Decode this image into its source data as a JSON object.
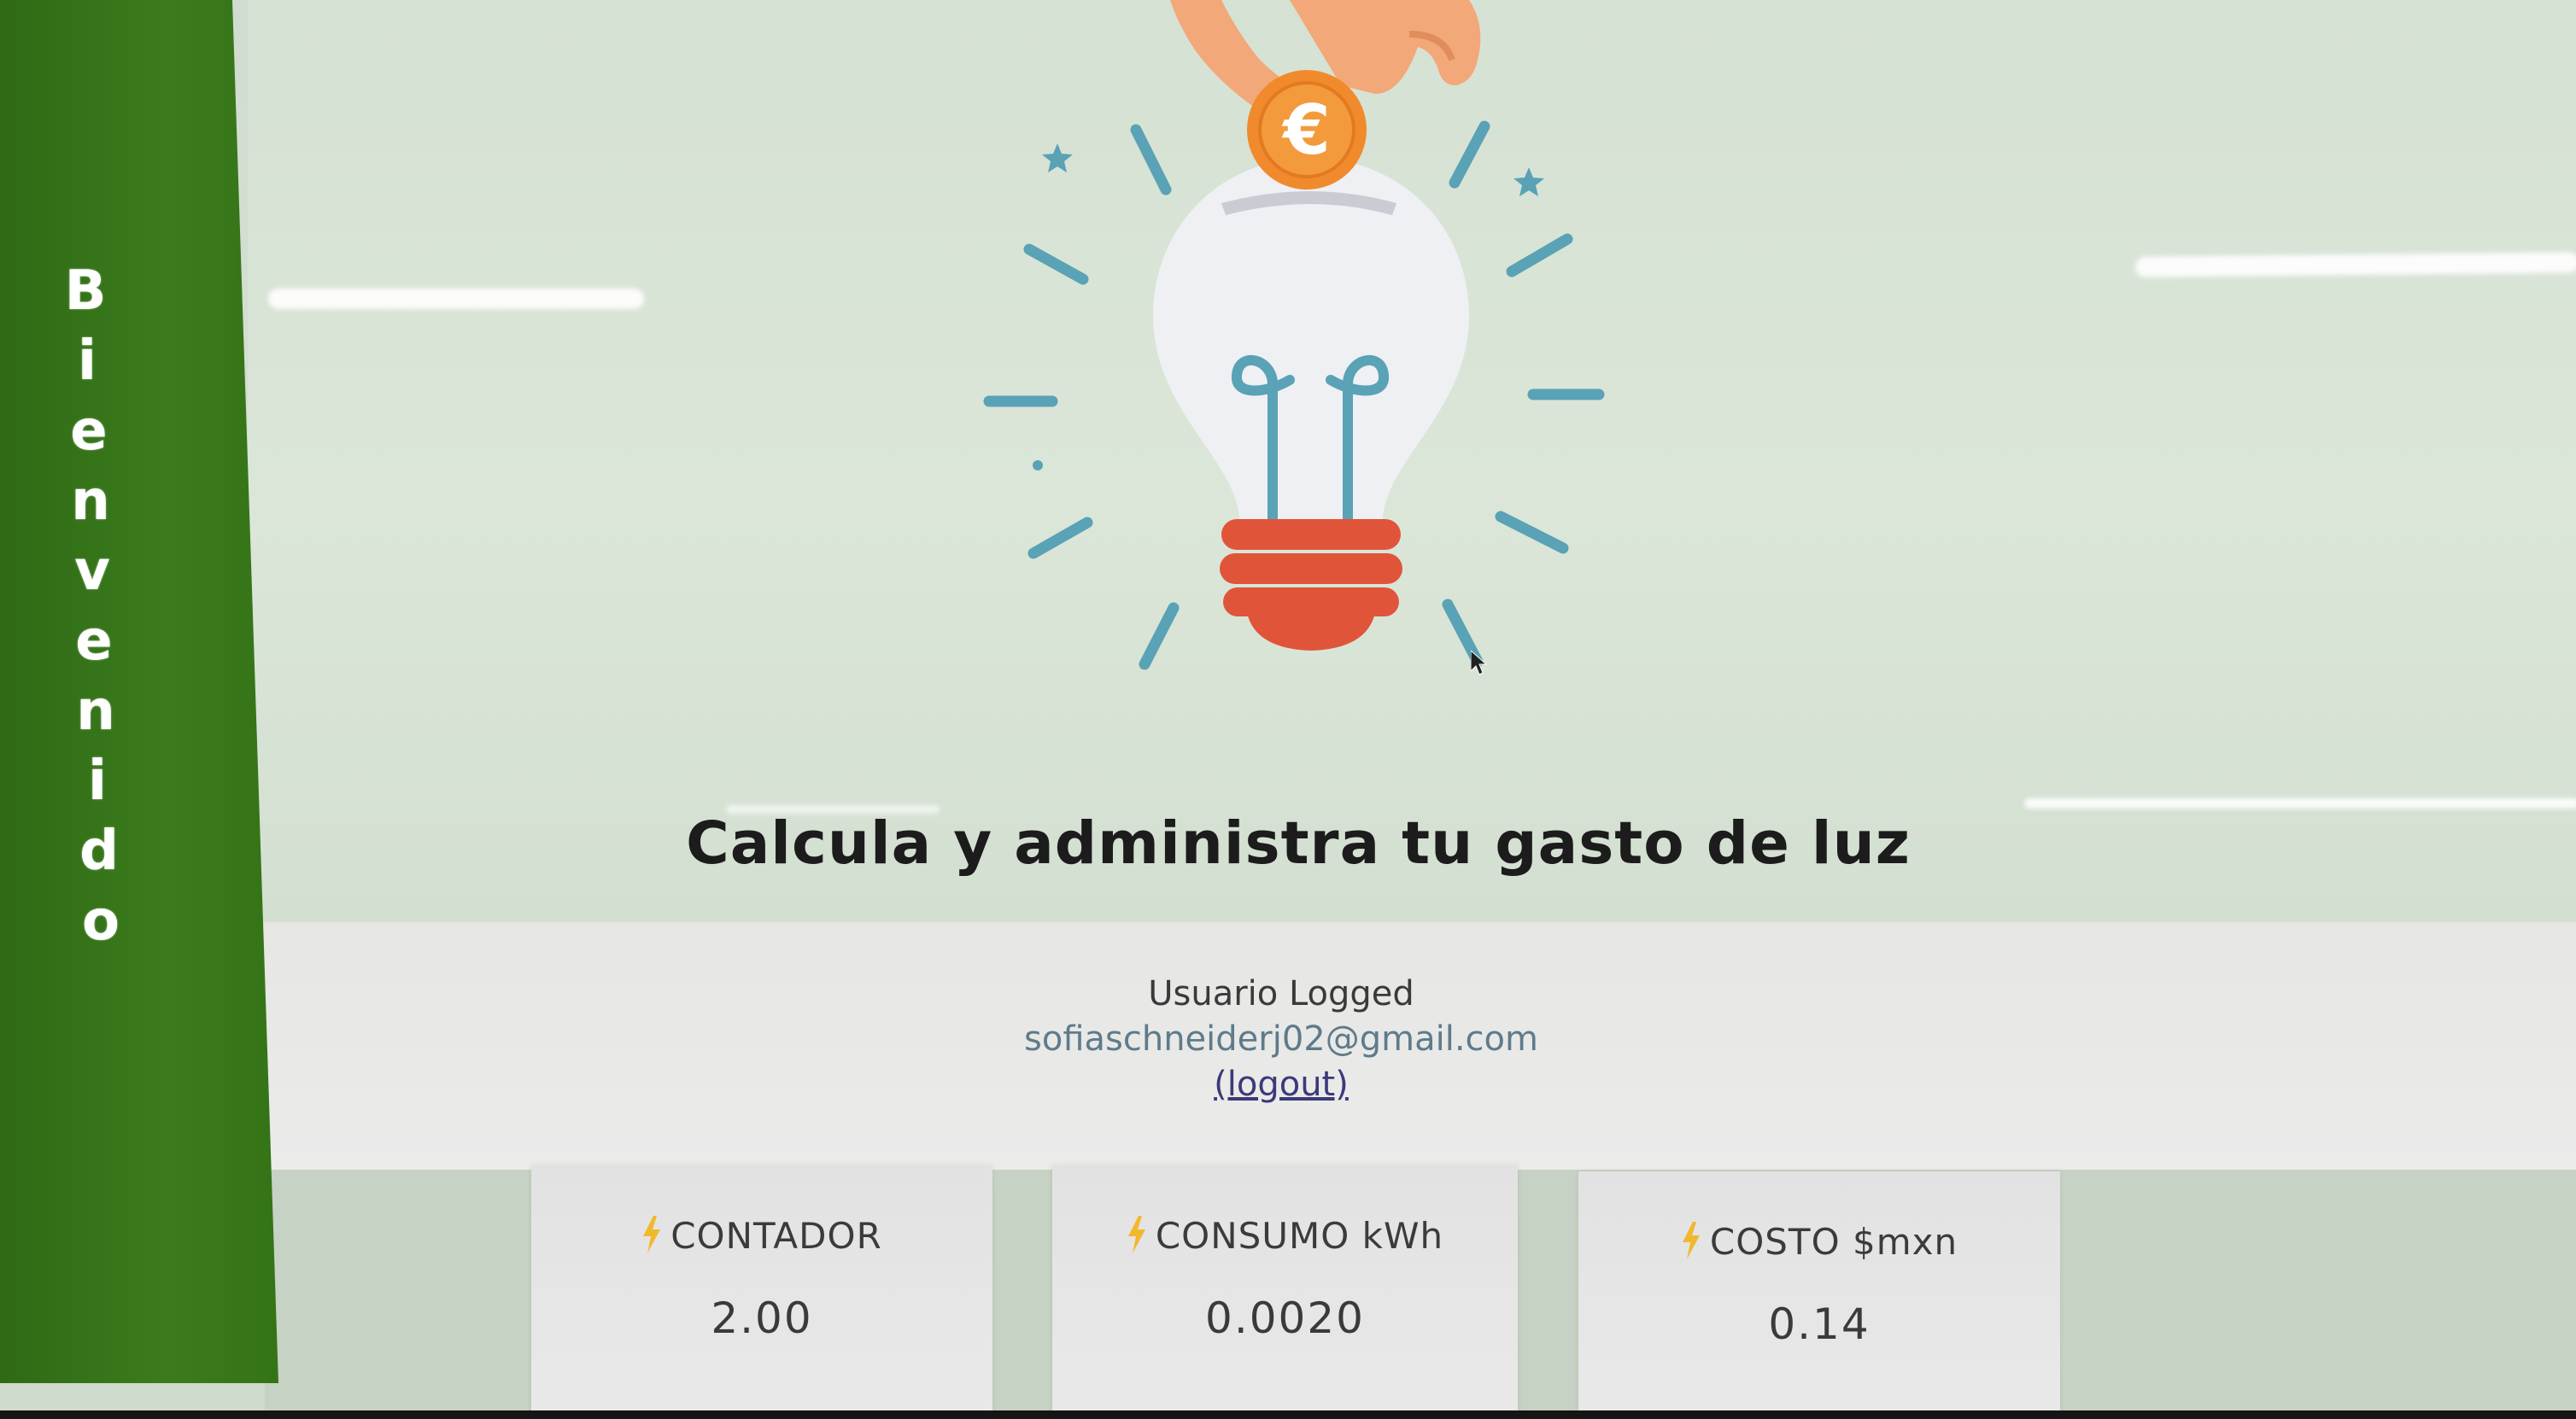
{
  "sidebar": {
    "letters": [
      "B",
      "i",
      "e",
      "n",
      "v",
      "e",
      "n",
      "i",
      "d",
      "o"
    ],
    "bg_color": "#3b7b1d"
  },
  "hero": {
    "title": "Calcula y administra tu gasto de luz",
    "illustration": {
      "icon_names": [
        "hand-icon",
        "euro-coin-icon",
        "light-bulb-icon"
      ],
      "coin_symbol": "€",
      "ray_color": "#5aa2b5",
      "base_color": "#e0553a",
      "coin_color": "#f08a2c"
    }
  },
  "user": {
    "label": "Usuario Logged",
    "email": "sofiaschneiderj02@gmail.com",
    "logout_label": "(logout)"
  },
  "cards": [
    {
      "label": "CONTADOR",
      "value": "2.00",
      "icon": "lightning-bolt-icon"
    },
    {
      "label": "CONSUMO kWh",
      "value": "0.0020",
      "icon": "lightning-bolt-icon"
    },
    {
      "label": "COSTO $mxn",
      "value": "0.14",
      "icon": "lightning-bolt-icon"
    }
  ],
  "colors": {
    "accent_green": "#3b7b1d",
    "bolt_yellow": "#f2b82d"
  }
}
